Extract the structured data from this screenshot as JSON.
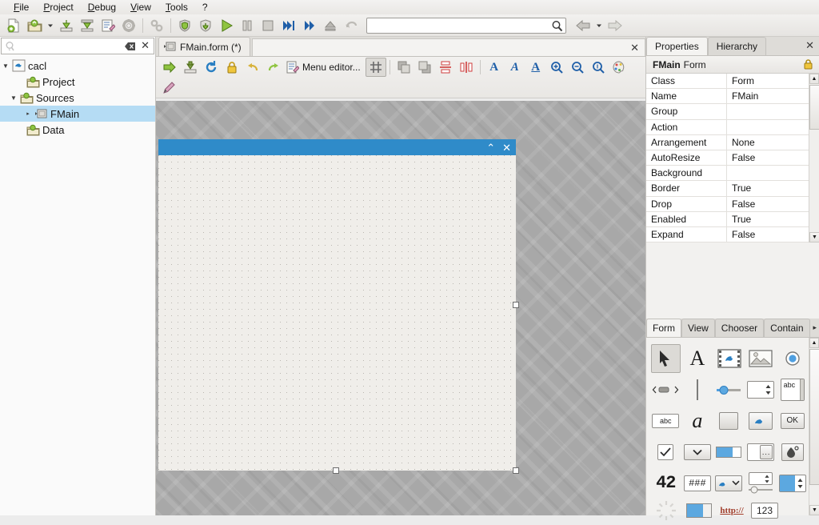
{
  "menu": {
    "items": [
      {
        "label": "File",
        "accel": "F"
      },
      {
        "label": "Project",
        "accel": "P"
      },
      {
        "label": "Debug",
        "accel": "D"
      },
      {
        "label": "View",
        "accel": "V"
      },
      {
        "label": "Tools",
        "accel": "T"
      },
      {
        "label": "?",
        "accel": ""
      }
    ]
  },
  "toolbar": {
    "buttons": [
      {
        "name": "new-project-icon",
        "title": "New project"
      },
      {
        "name": "open-project-icon",
        "title": "Open project"
      },
      {
        "name": "open-project-dropdown-icon",
        "title": "Recent projects"
      },
      {
        "name": "save-icon",
        "title": "Save"
      },
      {
        "name": "save-all-icon",
        "title": "Save all"
      },
      {
        "name": "edit-icon",
        "title": "Edit"
      },
      {
        "name": "gear-icon",
        "title": "Project properties"
      },
      {
        "name": "refactor-icon",
        "title": "Refactoring"
      },
      {
        "name": "shield-icon",
        "title": "Compile"
      },
      {
        "name": "shield-all-icon",
        "title": "Compile all"
      },
      {
        "name": "run-icon",
        "title": "Run"
      },
      {
        "name": "pause-icon",
        "title": "Pause"
      },
      {
        "name": "stop-icon",
        "title": "Stop"
      },
      {
        "name": "step-icon",
        "title": "Step"
      },
      {
        "name": "forward-icon",
        "title": "Forward"
      },
      {
        "name": "step-out-icon",
        "title": "Return"
      },
      {
        "name": "undo-run-icon",
        "title": "Return"
      }
    ],
    "search": {
      "value": "",
      "placeholder": "",
      "icon": "search-icon"
    },
    "nav_back": {
      "name": "back-icon",
      "label": "◀"
    },
    "nav_back_menu": {
      "name": "back-dropdown-icon",
      "label": "▾"
    },
    "nav_forward": {
      "name": "forward-nav-icon",
      "label": "▶"
    }
  },
  "project_tree": {
    "search": {
      "value": "",
      "placeholder": "",
      "icon": "search-icon"
    },
    "clear_icon": "clear-icon",
    "close_icon": "close-icon",
    "nodes": [
      {
        "label": "cacl",
        "icon": "gambas-project-icon",
        "twisty": "▼",
        "indent": 0,
        "selected": false
      },
      {
        "label": "Project",
        "icon": "folder-icon",
        "twisty": "",
        "indent": 1,
        "selected": false
      },
      {
        "label": "Sources",
        "icon": "folder-icon",
        "twisty": "▼",
        "indent": 1,
        "selected": false
      },
      {
        "label": "FMain",
        "icon": "form-icon",
        "twisty": "▸",
        "indent": 2,
        "selected": true
      },
      {
        "label": "Data",
        "icon": "folder-icon",
        "twisty": "",
        "indent": 1,
        "selected": false
      }
    ]
  },
  "editor": {
    "tab": {
      "label": "FMain.form (*)",
      "icon": "form-icon"
    },
    "tab_close_icon": "close-icon",
    "form_toolbar": {
      "buttons": [
        {
          "name": "open-code-icon",
          "title": "Open code"
        },
        {
          "name": "save-form-icon",
          "title": "Save"
        },
        {
          "name": "reload-icon",
          "title": "Reload"
        },
        {
          "name": "lock-icon",
          "title": "Lock"
        },
        {
          "name": "undo-icon",
          "title": "Undo"
        },
        {
          "name": "redo-icon",
          "title": "Redo"
        }
      ],
      "menu_editor_label": "Menu editor...",
      "menu_editor_icon": "menu-editor-icon",
      "grid_icon": "grid-icon",
      "grid_pressed": true,
      "align_buttons": [
        {
          "name": "bring-front-icon",
          "title": "Bring to front"
        },
        {
          "name": "send-back-icon",
          "title": "Send to back"
        },
        {
          "name": "align-vertical-icon",
          "title": "Align vertical"
        },
        {
          "name": "align-horizontal-icon",
          "title": "Align horizontal"
        }
      ],
      "font_buttons": [
        {
          "name": "font-bold-icon",
          "label": "A"
        },
        {
          "name": "font-italic-icon",
          "label": "A"
        },
        {
          "name": "font-underline-icon",
          "label": "A"
        }
      ],
      "zoom_buttons": [
        {
          "name": "zoom-in-icon",
          "title": "Zoom in"
        },
        {
          "name": "zoom-out-icon",
          "title": "Zoom out"
        },
        {
          "name": "zoom-reset-icon",
          "title": "Zoom 100%"
        }
      ],
      "palette_icon": "palette-icon",
      "pencil_icon": "pencil-icon"
    },
    "form_window": {
      "titlebar_buttons": [
        {
          "name": "form-collapse-icon",
          "label": "⌃"
        },
        {
          "name": "form-close-icon",
          "label": "✕"
        }
      ],
      "selected": true
    }
  },
  "right_panel": {
    "tabs": [
      {
        "label": "Properties",
        "active": true
      },
      {
        "label": "Hierarchy",
        "active": false
      }
    ],
    "close_icon": "close-icon",
    "object_name": "FMain",
    "object_class": "Form",
    "lock_icon": "lock-icon",
    "properties": {
      "rows": [
        {
          "name": "Class",
          "value": "Form"
        },
        {
          "name": "Name",
          "value": "FMain"
        },
        {
          "name": "Group",
          "value": ""
        },
        {
          "name": "Action",
          "value": ""
        },
        {
          "name": "Arrangement",
          "value": "None"
        },
        {
          "name": "AutoResize",
          "value": "False"
        },
        {
          "name": "Background",
          "value": ""
        },
        {
          "name": "Border",
          "value": "True"
        },
        {
          "name": "Drop",
          "value": "False"
        },
        {
          "name": "Enabled",
          "value": "True"
        },
        {
          "name": "Expand",
          "value": "False"
        }
      ]
    },
    "scroll_up_icon": "scroll-up-icon",
    "scroll_down_icon": "scroll-down-icon"
  },
  "toolbox": {
    "tabs": [
      {
        "label": "Form",
        "active": true
      },
      {
        "label": "View",
        "active": false
      },
      {
        "label": "Chooser",
        "active": false
      },
      {
        "label": "Contain",
        "active": false
      }
    ],
    "more_icon": "chevron-right-icon",
    "rows": [
      [
        {
          "name": "pointer-tool",
          "kind": "pointer",
          "selected": true
        },
        {
          "name": "label-widget",
          "kind": "glyph",
          "text": "A"
        },
        {
          "name": "movie-widget",
          "kind": "film"
        },
        {
          "name": "picture-widget",
          "kind": "picture"
        },
        {
          "name": "radiobutton-widget",
          "kind": "radio"
        }
      ],
      [
        {
          "name": "scrollbar-widget",
          "kind": "scrollbar"
        },
        {
          "name": "separator-widget",
          "kind": "separator"
        },
        {
          "name": "slider-widget",
          "kind": "slider"
        },
        {
          "name": "spinbox-widget",
          "kind": "spin"
        },
        {
          "name": "textarea-widget",
          "kind": "textarea",
          "text": "abc"
        }
      ],
      [
        {
          "name": "textbox-widget",
          "kind": "textbox",
          "text": "abc"
        },
        {
          "name": "textlabel-widget",
          "kind": "glyph-italic",
          "text": "a"
        },
        {
          "name": "panel-widget",
          "kind": "panel"
        },
        {
          "name": "imagebutton-widget",
          "kind": "birdbutton"
        },
        {
          "name": "button-widget",
          "kind": "okbutton",
          "text": "OK"
        }
      ],
      [
        {
          "name": "checkbox-widget",
          "kind": "checkbox"
        },
        {
          "name": "combobox-widget",
          "kind": "combo"
        },
        {
          "name": "toggle-widget",
          "kind": "toggle"
        },
        {
          "name": "filechooser-widget",
          "kind": "filechooser",
          "text": "..."
        },
        {
          "name": "colorbutton-widget",
          "kind": "colorbutton"
        }
      ],
      [
        {
          "name": "lcdnumber-widget",
          "kind": "lcd",
          "text": "42"
        },
        {
          "name": "maskbox-widget",
          "kind": "mask",
          "text": "###"
        },
        {
          "name": "imagecombo-widget",
          "kind": "birdcombo"
        },
        {
          "name": "spinslider-widget",
          "kind": "spinslider"
        },
        {
          "name": "colorspin-widget",
          "kind": "colorspin"
        }
      ],
      [
        {
          "name": "spinner-widget",
          "kind": "spinner"
        },
        {
          "name": "switch-widget",
          "kind": "switch"
        },
        {
          "name": "urllabel-widget",
          "kind": "url",
          "text": "http://"
        },
        {
          "name": "valuebox-widget",
          "kind": "valuebox",
          "text": "123"
        }
      ]
    ]
  },
  "colors": {
    "form_titlebar": "#2f8bc9",
    "selection": "#b5dcf4",
    "desktop": "#a8a8a8",
    "form_body": "#f0eeea",
    "accent_blue": "#5ca8e0"
  }
}
